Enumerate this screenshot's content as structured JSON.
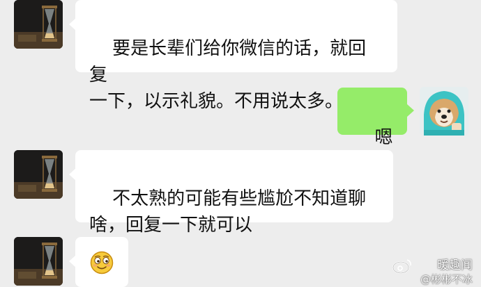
{
  "messages": [
    {
      "side": "left",
      "text": "要是长辈们给你微信的话，就回复\n一下，以示礼貌。不用说太多。"
    },
    {
      "side": "right",
      "text": "嗯嗯"
    },
    {
      "side": "left",
      "text": "不太熟的可能有些尴尬不知道聊\n啥，回复一下就可以"
    },
    {
      "side": "left",
      "text": "",
      "emoji": "smiling-face-emoji"
    }
  ],
  "watermark": {
    "line1": "暖趣闻",
    "line2": "@彬彬不冰"
  },
  "colors": {
    "background": "#ededed",
    "incoming_bubble": "#ffffff",
    "outgoing_bubble": "#95ec69"
  }
}
